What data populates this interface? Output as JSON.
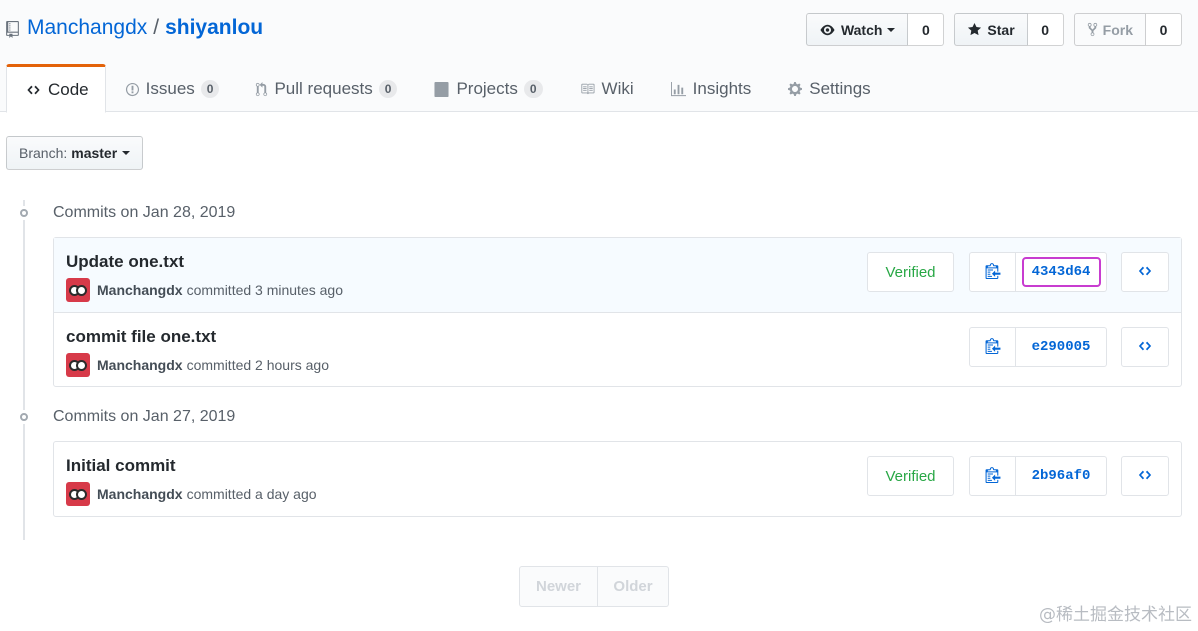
{
  "repo": {
    "owner": "Manchangdx",
    "separator": "/",
    "name": "shiyanlou"
  },
  "actions": {
    "watch": {
      "label": "Watch",
      "count": "0",
      "icon": "eye-icon"
    },
    "star": {
      "label": "Star",
      "count": "0",
      "icon": "star-icon"
    },
    "fork": {
      "label": "Fork",
      "count": "0",
      "icon": "fork-icon"
    }
  },
  "tabs": [
    {
      "label": "Code",
      "icon": "code-icon",
      "selected": true
    },
    {
      "label": "Issues",
      "count": "0",
      "icon": "issue-icon"
    },
    {
      "label": "Pull requests",
      "count": "0",
      "icon": "pull-request-icon"
    },
    {
      "label": "Projects",
      "count": "0",
      "icon": "project-icon"
    },
    {
      "label": "Wiki",
      "icon": "book-icon"
    },
    {
      "label": "Insights",
      "icon": "graph-icon"
    },
    {
      "label": "Settings",
      "icon": "gear-icon"
    }
  ],
  "branch": {
    "label": "Branch:",
    "value": "master"
  },
  "groups": [
    {
      "title": "Commits on Jan 28, 2019",
      "commits": [
        {
          "title": "Update one.txt",
          "author": "Manchangdx",
          "time": "committed 3 minutes ago",
          "verified": "Verified",
          "sha": "4343d64"
        },
        {
          "title": "commit file one.txt",
          "author": "Manchangdx",
          "time": "committed 2 hours ago",
          "sha": "e290005"
        }
      ]
    },
    {
      "title": "Commits on Jan 27, 2019",
      "commits": [
        {
          "title": "Initial commit",
          "author": "Manchangdx",
          "time": "committed a day ago",
          "verified": "Verified",
          "sha": "2b96af0"
        }
      ]
    }
  ],
  "pagination": {
    "newer": "Newer",
    "older": "Older"
  },
  "watermark": "@稀土掘金技术社区",
  "colors": {
    "link": "#0366d6",
    "verified": "#28a745",
    "highlight": "#c83cd0",
    "tab_accent": "#e36209"
  }
}
